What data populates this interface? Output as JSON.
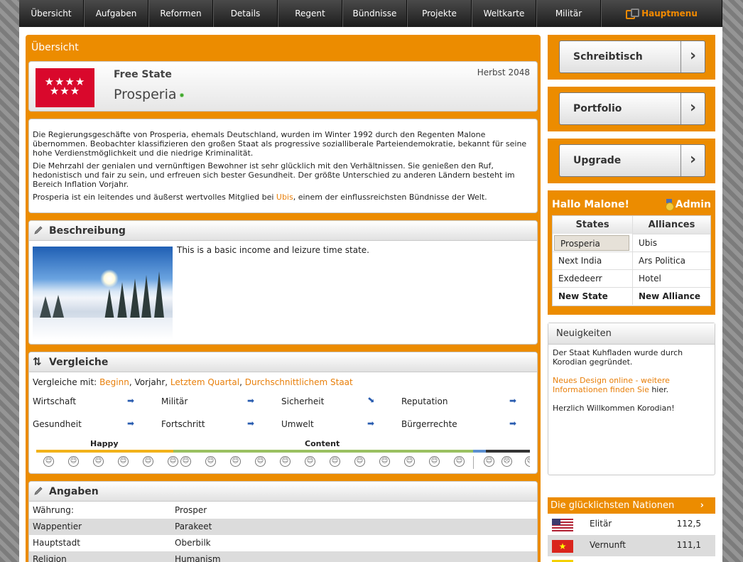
{
  "nav": {
    "tabs": [
      "Übersicht",
      "Aufgaben",
      "Reformen",
      "Details",
      "Regent",
      "Bündnisse",
      "Projekte",
      "Weltkarte",
      "Militär"
    ],
    "home_label": "Hauptmenu"
  },
  "overview": {
    "title": "Übersicht",
    "state_type": "Free State",
    "state_name": "Prosperia",
    "season": "Herbst 2048",
    "flag_stars": "★★★★\n★★★",
    "intro_p1": "Die Regierungsgeschäfte von Prosperia, ehemals Deutschland, wurden im Winter 1992 durch den Regenten Malone übernommen. Beobachter klassifizieren den großen Staat als progressive sozialliberale Parteiendemokratie, bekannt für seine hohe Verdienstmöglichkeit und die niedrige Kriminalität.",
    "intro_p2": "Die Mehrzahl der genialen und vernünftigen Bewohner ist sehr glücklich mit den Verhältnissen. Sie genießen den Ruf, hedonistisch und fair zu sein, und erfreuen sich bester Gesundheit. Der größte Unterschied zu anderen Ländern besteht im Bereich Inflation Vorjahr.",
    "intro_p3_a": "Prosperia ist ein leitendes und äußerst wertvolles Mitglied bei ",
    "intro_p3_link": "Ubis",
    "intro_p3_b": ", einem der einflussreichsten Bündnisse der Welt."
  },
  "beschreibung": {
    "title": "Beschreibung",
    "text": "This is a basic income and leizure time state."
  },
  "vergleiche": {
    "title": "Vergleiche",
    "prefix": "Vergleiche mit:",
    "link1": "Beginn",
    "sep1": ", Vorjahr, ",
    "link2": "Letztem Quartal",
    "sep2": ", ",
    "link3": "Durchschnittlichem Staat",
    "metrics": [
      {
        "label": "Wirtschaft",
        "trend": "right"
      },
      {
        "label": "Militär",
        "trend": "right"
      },
      {
        "label": "Sicherheit",
        "trend": "down-right"
      },
      {
        "label": "Reputation",
        "trend": "right"
      },
      {
        "label": "Gesundheit",
        "trend": "right"
      },
      {
        "label": "Fortschritt",
        "trend": "right"
      },
      {
        "label": "Umwelt",
        "trend": "right"
      },
      {
        "label": "Bürgerrechte",
        "trend": "right"
      }
    ],
    "mood_happy": "Happy",
    "mood_content": "Content",
    "colors": {
      "happy": "#f2b21a",
      "content": "#9ac061",
      "neutral": "#5b8fd0",
      "sad": "#333333"
    }
  },
  "angaben": {
    "title": "Angaben",
    "rows": [
      {
        "k": "Währung:",
        "v": "Prosper"
      },
      {
        "k": "Wappentier",
        "v": "Parakeet"
      },
      {
        "k": "Hauptstadt",
        "v": "Oberbilk"
      },
      {
        "k": "Religion",
        "v": "Humanism"
      }
    ]
  },
  "sidebar": {
    "buttons": [
      "Schreibtisch",
      "Portfolio",
      "Upgrade"
    ],
    "hallo": "Hallo Malone!",
    "admin": "Admin",
    "states_header": "States",
    "alliances_header": "Alliances",
    "states": [
      "Prosperia",
      "Next India",
      "Exdedeerr",
      "New State"
    ],
    "alliances": [
      "Ubis",
      "Ars Politica",
      "Hotel",
      "New Alliance"
    ],
    "news_title": "Neuigkeiten",
    "news_1": "Der Staat Kuhfladen wurde durch Korodian gegründet.",
    "news_2_link": "Neues Design online - weitere Informationen finden Sie",
    "news_2_tail": " hier.",
    "news_3": "Herzlich Willkommen Korodian!",
    "happiest_title": "Die glücklichsten Nationen",
    "nations": [
      {
        "name": "Elitär",
        "value": "112,5"
      },
      {
        "name": "Vernunft",
        "value": "111,1"
      }
    ]
  }
}
